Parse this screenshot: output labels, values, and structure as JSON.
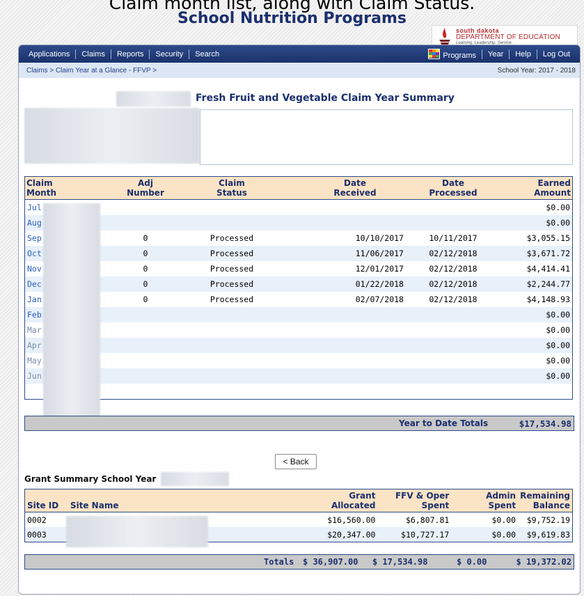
{
  "caption": "Claim month list, along with Claim Status.",
  "app_title": "School Nutrition Programs",
  "logo": {
    "line1": "south dakota",
    "line2": "DEPARTMENT OF EDUCATION",
    "tagline": "Learning. Leadership. Service."
  },
  "nav": {
    "applications": "Applications",
    "claims": "Claims",
    "reports": "Reports",
    "security": "Security",
    "search": "Search",
    "programs": "Programs",
    "year": "Year",
    "help": "Help",
    "logout": "Log Out"
  },
  "breadcrumb": "Claims > Claim Year at a Glance - FFVP >",
  "school_year": "School Year: 2017 - 2018",
  "summary_title": "Fresh Fruit and Vegetable Claim Year Summary",
  "claims_table": {
    "headers": {
      "month_line1": "Claim",
      "month_line2": "Month",
      "adj_line1": "Adj",
      "adj_line2": "Number",
      "status_line1": "Claim",
      "status_line2": "Status",
      "received_line1": "Date",
      "received_line2": "Received",
      "processed_line1": "Date",
      "processed_line2": "Processed",
      "earned_line1": "Earned",
      "earned_line2": "Amount"
    },
    "rows": [
      {
        "month": "Jul 2",
        "adj": "",
        "status": "",
        "received": "",
        "processed": "",
        "earned": "$0.00"
      },
      {
        "month": "Aug",
        "adj": "",
        "status": "",
        "received": "",
        "processed": "",
        "earned": "$0.00"
      },
      {
        "month": "Sep",
        "adj": "0",
        "status": "Processed",
        "received": "10/10/2017",
        "processed": "10/11/2017",
        "earned": "$3,055.15"
      },
      {
        "month": "Oct",
        "adj": "0",
        "status": "Processed",
        "received": "11/06/2017",
        "processed": "02/12/2018",
        "earned": "$3,671.72"
      },
      {
        "month": "Nov",
        "adj": "0",
        "status": "Processed",
        "received": "12/01/2017",
        "processed": "02/12/2018",
        "earned": "$4,414.41"
      },
      {
        "month": "Dec",
        "adj": "0",
        "status": "Processed",
        "received": "01/22/2018",
        "processed": "02/12/2018",
        "earned": "$2,244.77"
      },
      {
        "month": "Jan",
        "adj": "0",
        "status": "Processed",
        "received": "02/07/2018",
        "processed": "02/12/2018",
        "earned": "$4,148.93"
      },
      {
        "month": "Feb",
        "adj": "",
        "status": "",
        "received": "",
        "processed": "",
        "earned": "$0.00"
      },
      {
        "month": "Mar",
        "adj": "",
        "status": "",
        "received": "",
        "processed": "",
        "earned": "$0.00"
      },
      {
        "month": "Apr",
        "adj": "",
        "status": "",
        "received": "",
        "processed": "",
        "earned": "$0.00"
      },
      {
        "month": "May",
        "adj": "",
        "status": "",
        "received": "",
        "processed": "",
        "earned": "$0.00"
      },
      {
        "month": "Jun",
        "adj": "",
        "status": "",
        "received": "",
        "processed": "",
        "earned": "$0.00"
      }
    ]
  },
  "ytd": {
    "label": "Year to Date Totals",
    "value": "$17,534.98"
  },
  "back_button": "< Back",
  "grant_summary_label": "Grant Summary School Year",
  "grants_table": {
    "headers": {
      "site_id": "Site ID",
      "site_name": "Site Name",
      "alloc_line1": "Grant",
      "alloc_line2": "Allocated",
      "spent_line1": "FFV & Oper",
      "spent_line2": "Spent",
      "admin_line1": "Admin",
      "admin_line2": "Spent",
      "remaining_line1": "Remaining",
      "remaining_line2": "Balance"
    },
    "rows": [
      {
        "site_id": "0002",
        "site_name": "",
        "allocated": "$16,560.00",
        "spent": "$6,807.81",
        "admin": "$0.00",
        "remaining": "$9,752.19"
      },
      {
        "site_id": "0003",
        "site_name": "",
        "allocated": "$20,347.00",
        "spent": "$10,727.17",
        "admin": "$0.00",
        "remaining": "$9,619.83"
      }
    ]
  },
  "totals": {
    "label": "Totals",
    "allocated": "$ 36,907.00",
    "spent": "$ 17,534.98",
    "admin": "$ 0.00",
    "remaining": "$ 19,372.02"
  },
  "colors": {
    "nav_bg": "#1a326c",
    "header_bg": "#fbe3c5",
    "title": "#1b2f6e",
    "link": "#2a5fc0"
  }
}
